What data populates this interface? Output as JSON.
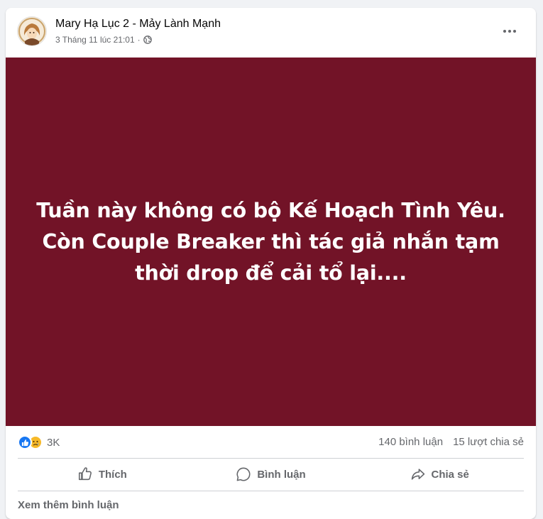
{
  "post": {
    "author": "Mary Hạ Lục 2 - Mảy Lành Mạnh",
    "timestamp": "3 Tháng 11 lúc 21:01",
    "separator": "·",
    "privacy_icon": "globe-icon",
    "banner_text": "Tuần này không có bộ Kế Hoạch Tình Yêu. Còn Couple Breaker thì tác giả nhắn tạm thời drop để cải tổ lại....",
    "banner_color": "#721327"
  },
  "stats": {
    "reaction_icons": [
      "like-icon",
      "sad-icon"
    ],
    "reaction_count": "3K",
    "comments": "140 bình luận",
    "shares": "15 lượt chia sẻ"
  },
  "actions": {
    "like_label": "Thích",
    "comment_label": "Bình luận",
    "share_label": "Chia sẻ"
  },
  "footer": {
    "view_more_comments": "Xem thêm bình luận"
  }
}
